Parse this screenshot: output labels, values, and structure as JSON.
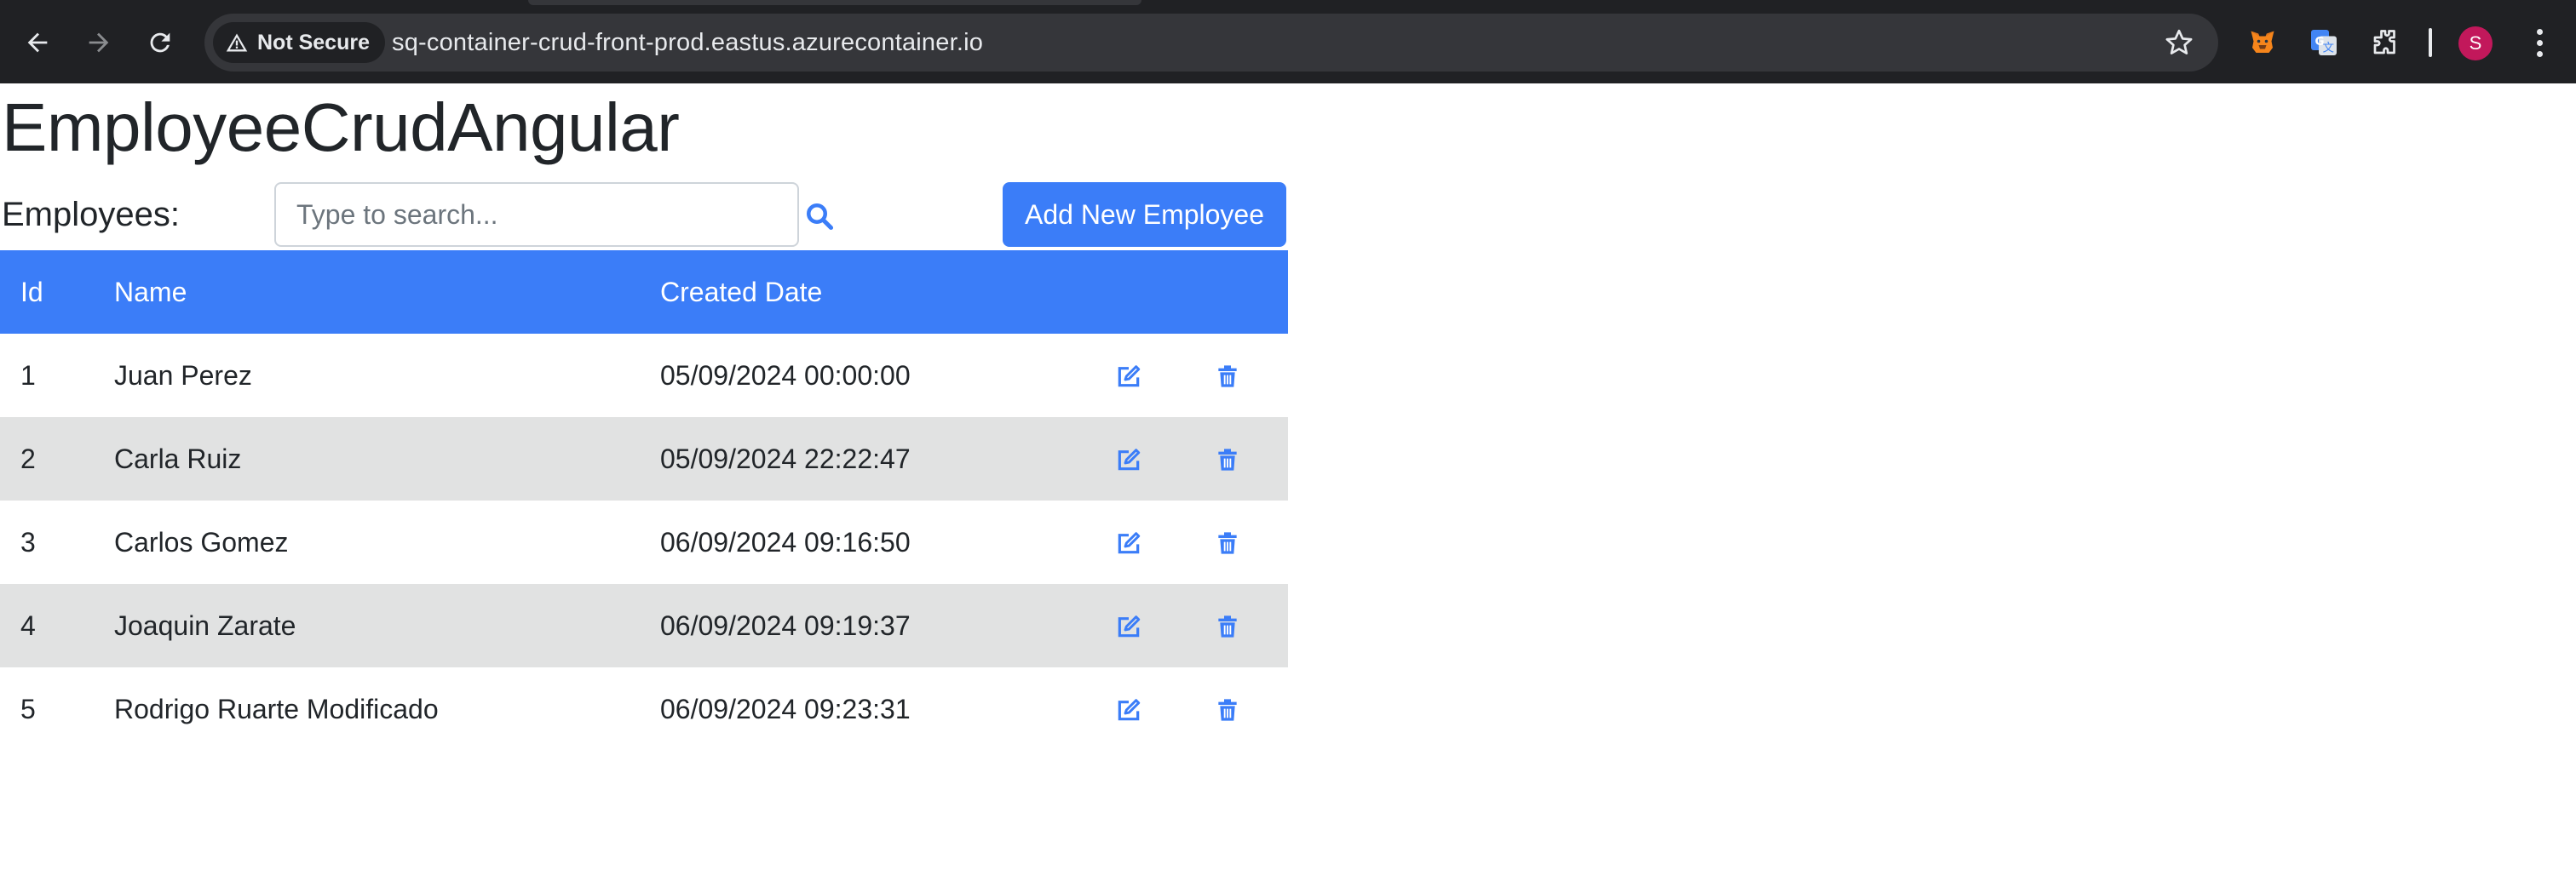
{
  "browser": {
    "security_chip": "Not Secure",
    "url": "sq-container-crud-front-prod.eastus.azurecontainer.io",
    "avatar_initial": "S",
    "icons": [
      "back-icon",
      "forward-icon",
      "reload-icon",
      "warning-icon",
      "star-icon",
      "metamask-icon",
      "google-translate-icon",
      "extensions-icon",
      "more-icon"
    ]
  },
  "page": {
    "title": "EmployeeCrudAngular",
    "employees_label": "Employees:",
    "search_placeholder": "Type to search...",
    "search_value": "",
    "add_button": "Add New Employee"
  },
  "table": {
    "columns": [
      "Id",
      "Name",
      "Created Date"
    ],
    "rows": [
      {
        "id": "1",
        "name": "Juan Perez",
        "created": "05/09/2024 00:00:00"
      },
      {
        "id": "2",
        "name": "Carla Ruiz",
        "created": "05/09/2024 22:22:47"
      },
      {
        "id": "3",
        "name": "Carlos Gomez",
        "created": "06/09/2024 09:16:50"
      },
      {
        "id": "4",
        "name": "Joaquin Zarate",
        "created": "06/09/2024 09:19:37"
      },
      {
        "id": "5",
        "name": "Rodrigo Ruarte Modificado",
        "created": "06/09/2024 09:23:31"
      }
    ],
    "row_actions": [
      "edit-icon",
      "trash-icon"
    ]
  },
  "colors": {
    "primary": "#3b7df8",
    "stripe": "#e1e2e2",
    "chrome_bg": "#202124",
    "omnibox_bg": "#35363a"
  }
}
